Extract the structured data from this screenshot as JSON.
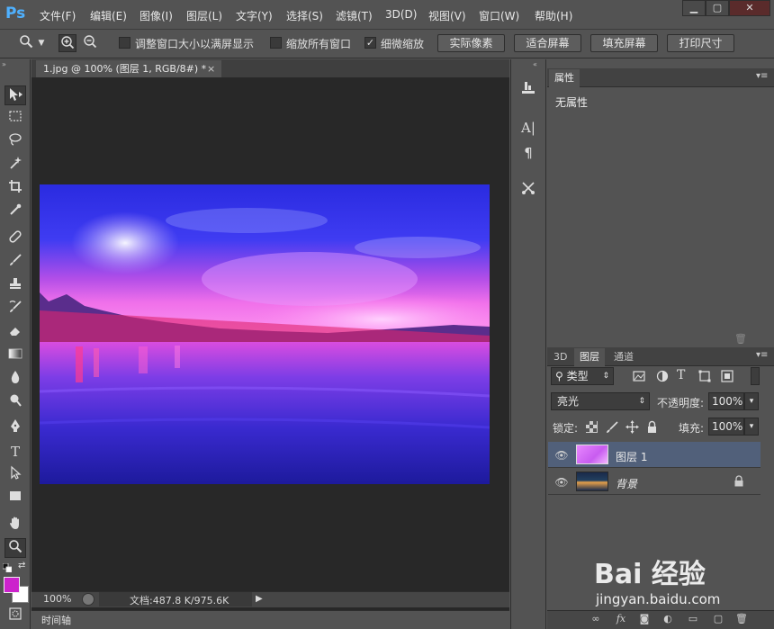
{
  "app": {
    "logo": "Ps"
  },
  "menu": [
    "文件(F)",
    "编辑(E)",
    "图像(I)",
    "图层(L)",
    "文字(Y)",
    "选择(S)",
    "滤镜(T)",
    "3D(D)",
    "视图(V)",
    "窗口(W)",
    "帮助(H)"
  ],
  "window_controls": {
    "minimize": "▁",
    "restore": "▢",
    "close": "✕"
  },
  "options": {
    "tool_icon": "magnifier-icon",
    "zoom_in_icon": "zoom-in-icon",
    "zoom_out_icon": "zoom-out-icon",
    "resize_windows_label": "调整窗口大小以满屏显示",
    "resize_windows_checked": false,
    "zoom_all_label": "缩放所有窗口",
    "zoom_all_checked": false,
    "scrubby_zoom_label": "细微缩放",
    "scrubby_zoom_checked": true,
    "actual_pixels": "实际像素",
    "fit_screen": "适合屏幕",
    "fill_screen": "填充屏幕",
    "print_size": "打印尺寸"
  },
  "document": {
    "tab_title": "1.jpg @ 100% (图层 1, RGB/8#) *",
    "tab_close": "×",
    "zoom": "100%",
    "doc_info": "文档:487.8 K/975.6K"
  },
  "timeline_label": "时间轴",
  "properties": {
    "tab": "属性",
    "content": "无属性"
  },
  "layers_panel": {
    "tabs": [
      "3D",
      "图层",
      "通道"
    ],
    "active_tab": "图层",
    "filter_kind": "类型",
    "blend_mode": "亮光",
    "opacity_label": "不透明度:",
    "opacity": "100%",
    "lock_label": "锁定:",
    "fill_label": "填充:",
    "fill": "100%",
    "layers": [
      {
        "name": "图层 1",
        "visible": true,
        "selected": true,
        "locked": false
      },
      {
        "name": "背景",
        "visible": true,
        "selected": false,
        "locked": true
      }
    ]
  },
  "colors": {
    "foreground": "#cc22cc",
    "background": "#ffffff",
    "selection": "#51607a"
  },
  "watermark": {
    "brand": "Bai  经验",
    "url": "jingyan.baidu.com"
  }
}
